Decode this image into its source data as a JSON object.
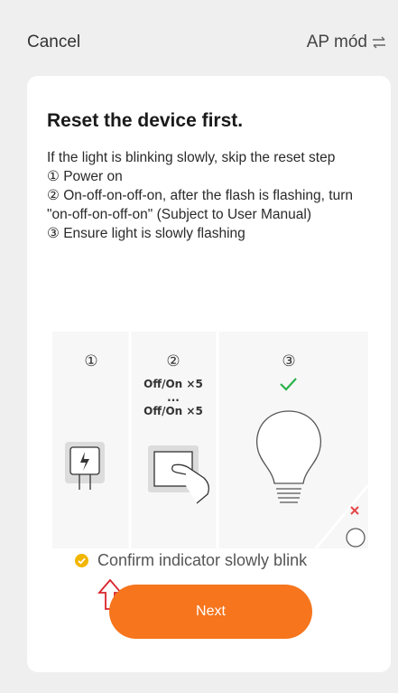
{
  "header": {
    "cancel_label": "Cancel",
    "mode_label": "AP mód"
  },
  "card": {
    "title": "Reset the device first.",
    "lines": [
      "If the light is blinking slowly, skip the reset step",
      "① Power on",
      "② On-off-on-off-on, after the flash is flashing, turn \"on-off-on-off-on\" (Subject to User Manual)",
      "③ Ensure  light is slowly flashing"
    ]
  },
  "illustration": {
    "step1_num": "①",
    "step2_num": "②",
    "step3_num": "③",
    "step2_line1": "Off/On ×5",
    "step2_dots": "...",
    "step2_line2": "Off/On ×5"
  },
  "confirm": {
    "label": "Confirm indicator slowly blink"
  },
  "next_button": {
    "label": "Next"
  },
  "colors": {
    "accent": "#f6751d",
    "confirm_check": "#f2b500",
    "success_check": "#2bb24c",
    "error_x": "#e64646",
    "indicator_arrow": "#d8232a"
  }
}
